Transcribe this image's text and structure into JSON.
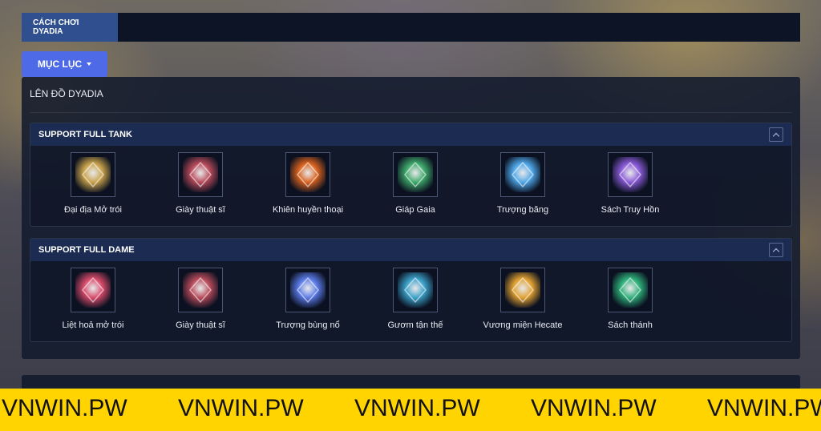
{
  "topbar": {
    "tab_label": "CÁCH CHƠI DYADIA"
  },
  "menu": {
    "label": "MỤC LỤC"
  },
  "section": {
    "title": "LÊN ĐỒ DYADIA"
  },
  "builds": [
    {
      "title": "SUPPORT FULL TANK",
      "items": [
        {
          "name": "Đại địa Mở trói",
          "icon": "gold-rune-icon",
          "color": "#c9a24a"
        },
        {
          "name": "Giày thuật sĩ",
          "icon": "boots-icon",
          "color": "#b84a5a"
        },
        {
          "name": "Khiên huyền thoại",
          "icon": "legend-shield-icon",
          "color": "#d9621e"
        },
        {
          "name": "Giáp Gaia",
          "icon": "gaia-armor-icon",
          "color": "#3ea86a"
        },
        {
          "name": "Trượng băng",
          "icon": "ice-staff-icon",
          "color": "#4ea6e8"
        },
        {
          "name": "Sách Truy Hồn",
          "icon": "soul-book-icon",
          "color": "#8a5ad8"
        }
      ]
    },
    {
      "title": "SUPPORT FULL DAME",
      "items": [
        {
          "name": "Liệt hoả mở trói",
          "icon": "fire-rune-icon",
          "color": "#d84a6a"
        },
        {
          "name": "Giày thuật sĩ",
          "icon": "boots-icon",
          "color": "#b84a5a"
        },
        {
          "name": "Trượng bùng nổ",
          "icon": "blast-staff-icon",
          "color": "#5a7ae8"
        },
        {
          "name": "Gươm tận thế",
          "icon": "doom-sword-icon",
          "color": "#3aa0c8"
        },
        {
          "name": "Vương miện Hecate",
          "icon": "hecate-crown-icon",
          "color": "#e0a030"
        },
        {
          "name": "Sách thánh",
          "icon": "holy-book-icon",
          "color": "#2eb07a"
        }
      ]
    }
  ],
  "banner": {
    "text": "VNWIN.PW"
  }
}
